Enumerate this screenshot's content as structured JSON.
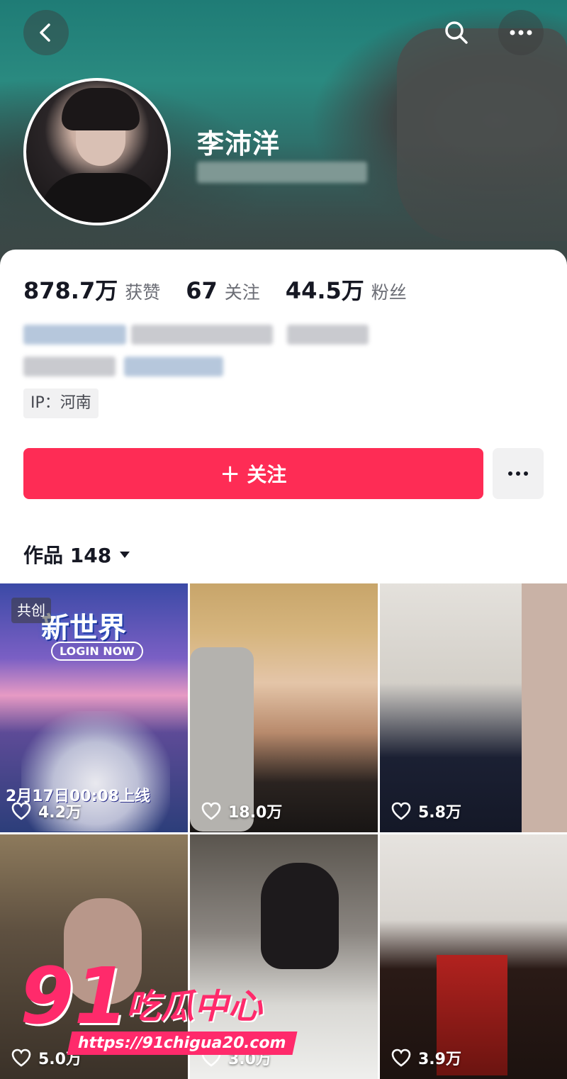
{
  "header": {
    "back_icon": "chevron-left-icon",
    "search_icon": "search-icon",
    "more_icon": "more-horizontal-icon"
  },
  "profile": {
    "name": "李沛洋"
  },
  "stats": [
    {
      "value": "878.7万",
      "label": "获赞"
    },
    {
      "value": "67",
      "label": "关注"
    },
    {
      "value": "44.5万",
      "label": "粉丝"
    }
  ],
  "ip_label": "IP：河南",
  "actions": {
    "follow_label": "＋ 关注",
    "more_icon": "more-horizontal-icon"
  },
  "works": {
    "label": "作品 148",
    "sort_icon": "caret-down-icon"
  },
  "videos": [
    {
      "likes": "4.2万",
      "badge": "共创",
      "poster_title": "新世界",
      "poster_sub": "LOGIN NOW",
      "poster_date": "2月17日00:08上线"
    },
    {
      "likes": "18.0万"
    },
    {
      "likes": "5.8万"
    },
    {
      "likes": "5.0万"
    },
    {
      "likes": "3.0万"
    },
    {
      "likes": "3.9万"
    }
  ],
  "watermark": {
    "number": "91",
    "text": "吃瓜中心",
    "url": "https://91chigua20.com"
  },
  "colors": {
    "accent": "#fe2c55",
    "text_primary": "#161823",
    "text_secondary": "#6b6d75"
  }
}
